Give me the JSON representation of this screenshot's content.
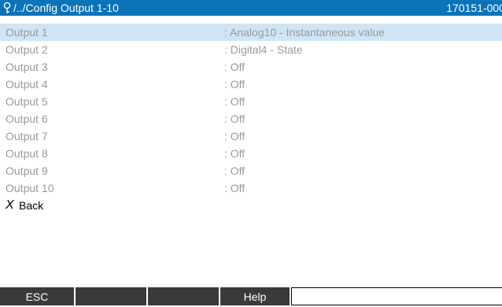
{
  "titlebar": {
    "path": "/../Config Output 1-10",
    "device_id": "170151-000"
  },
  "rows": [
    {
      "name": "Output 1",
      "value": ": Analog10 - Instantaneous value",
      "selected": true
    },
    {
      "name": "Output 2",
      "value": ": Digital4 - State",
      "selected": false
    },
    {
      "name": "Output 3",
      "value": ": Off",
      "selected": false
    },
    {
      "name": "Output 4",
      "value": ": Off",
      "selected": false
    },
    {
      "name": "Output 5",
      "value": ": Off",
      "selected": false
    },
    {
      "name": "Output 6",
      "value": ": Off",
      "selected": false
    },
    {
      "name": "Output 7",
      "value": ": Off",
      "selected": false
    },
    {
      "name": "Output 8",
      "value": ": Off",
      "selected": false
    },
    {
      "name": "Output 9",
      "value": ": Off",
      "selected": false
    },
    {
      "name": "Output 10",
      "value": ": Off",
      "selected": false
    }
  ],
  "back": {
    "icon": "X",
    "label": "Back"
  },
  "softkeys": [
    "ESC",
    "",
    "",
    "Help",
    ""
  ],
  "colors": {
    "titlebar": "#0b73b8",
    "selected_row": "#cfe5f5",
    "softkey": "#3a3a3a"
  }
}
